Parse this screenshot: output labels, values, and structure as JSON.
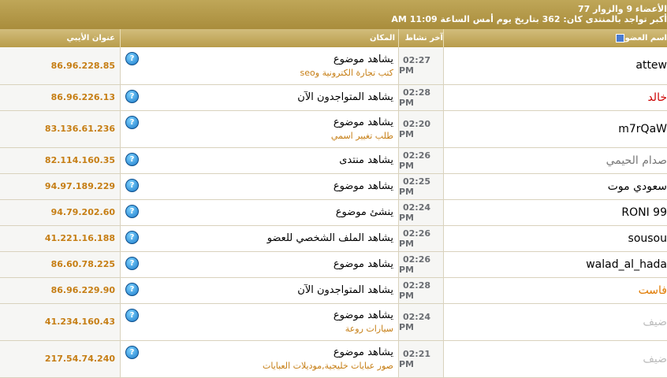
{
  "stats": {
    "line1": "الأعضاء 9 والزوار 77",
    "line2": "أكبر تواجد بالمنتدى كان: 362 بتاريخ يوم أمس الساعة 11:09 AM"
  },
  "headers": {
    "ip": "عنوان الأيبي",
    "location": "المكان",
    "last_activity": "آخر نشاط",
    "member": "اسم العضو"
  },
  "rows": [
    {
      "member": "attew",
      "member_color": "#000000",
      "time": "02:27 PM",
      "location": "يشاهد موضوع",
      "subtitle": "كتب تجارة الكترونية وseo",
      "ip": "86.96.228.85"
    },
    {
      "member": "خالد",
      "member_color": "#cc0000",
      "time": "02:28 PM",
      "location": "يشاهد المتواجدون الآن",
      "subtitle": "",
      "ip": "86.96.226.13"
    },
    {
      "member": "m7rQaW",
      "member_color": "#000000",
      "time": "02:20 PM",
      "location": "يشاهد موضوع",
      "subtitle": "طلب تغيير اسمي",
      "ip": "83.136.61.236"
    },
    {
      "member": "صدام الحيمي",
      "member_color": "#777777",
      "time": "02:26 PM",
      "location": "يشاهد منتدى",
      "subtitle": "",
      "ip": "82.114.160.35"
    },
    {
      "member": "سعودي موت",
      "member_color": "#000000",
      "time": "02:25 PM",
      "location": "يشاهد موضوع",
      "subtitle": "",
      "ip": "94.97.189.229"
    },
    {
      "member": "RONI 99",
      "member_color": "#000000",
      "time": "02:24 PM",
      "location": "ينشئ موضوع",
      "subtitle": "",
      "ip": "94.79.202.60"
    },
    {
      "member": "sousou",
      "member_color": "#000000",
      "time": "02:26 PM",
      "location": "يشاهد الملف الشخصي للعضو",
      "subtitle": "",
      "ip": "41.221.16.188"
    },
    {
      "member": "walad_al_hada",
      "member_color": "#000000",
      "time": "02:26 PM",
      "location": "يشاهد موضوع",
      "subtitle": "",
      "ip": "86.60.78.225"
    },
    {
      "member": "فاست",
      "member_color": "#e07a00",
      "time": "02:28 PM",
      "location": "يشاهد المتواجدون الآن",
      "subtitle": "",
      "ip": "86.96.229.90"
    },
    {
      "member": "ضيف",
      "member_color": "#bbbbbb",
      "time": "02:24 PM",
      "location": "يشاهد موضوع",
      "subtitle": "سيارات روعة",
      "ip": "41.234.160.43"
    },
    {
      "member": "ضيف",
      "member_color": "#bbbbbb",
      "time": "02:21 PM",
      "location": "يشاهد موضوع",
      "subtitle": "صور عبايات خليجية,موديلات العبايات",
      "ip": "217.54.74.240"
    }
  ]
}
